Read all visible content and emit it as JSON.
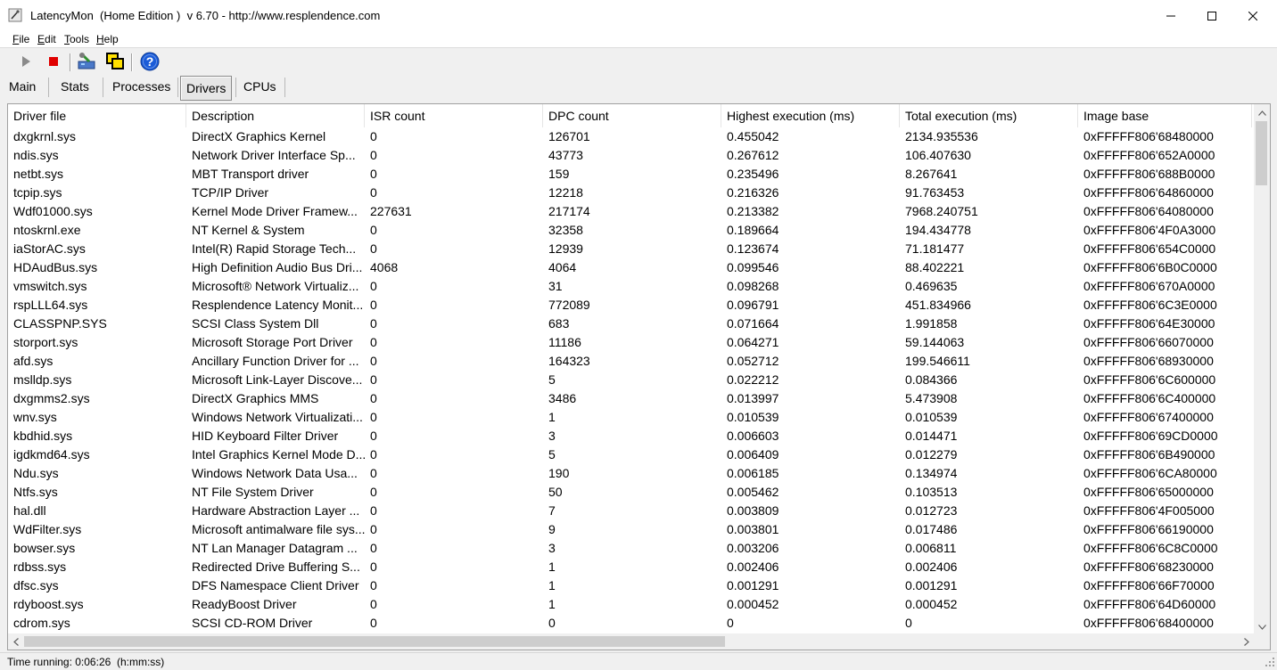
{
  "window": {
    "title": "LatencyMon  (Home Edition )  v 6.70 - http://www.resplendence.com",
    "icons": [
      "app-icon",
      "minimize-icon",
      "maximize-icon",
      "close-icon"
    ]
  },
  "menu": {
    "items": [
      {
        "accel": "F",
        "rest": "ile"
      },
      {
        "accel": "E",
        "rest": "dit"
      },
      {
        "accel": "T",
        "rest": "ools"
      },
      {
        "accel": "H",
        "rest": "elp"
      }
    ]
  },
  "toolbar": {
    "icons": [
      "play-icon",
      "stop-icon",
      "drivers-tool-icon",
      "windows-tool-icon",
      "help-icon"
    ],
    "colors": {
      "stop": "#e00000",
      "help": "#1a5bd8"
    }
  },
  "tabs": [
    {
      "label": "Main",
      "active": false
    },
    {
      "label": "Stats",
      "active": false
    },
    {
      "label": "Processes",
      "active": false
    },
    {
      "label": "Drivers",
      "active": true
    },
    {
      "label": "CPUs",
      "active": false
    }
  ],
  "table": {
    "columns": [
      "Driver file",
      "Description",
      "ISR count",
      "DPC count",
      "Highest execution (ms)",
      "Total execution (ms)",
      "Image base"
    ],
    "rows": [
      [
        "dxgkrnl.sys",
        "DirectX Graphics Kernel",
        "0",
        "126701",
        "0.455042",
        "2134.935536",
        "0xFFFFF806'68480000"
      ],
      [
        "ndis.sys",
        "Network Driver Interface Sp...",
        "0",
        "43773",
        "0.267612",
        "106.407630",
        "0xFFFFF806'652A0000"
      ],
      [
        "netbt.sys",
        "MBT Transport driver",
        "0",
        "159",
        "0.235496",
        "8.267641",
        "0xFFFFF806'688B0000"
      ],
      [
        "tcpip.sys",
        "TCP/IP Driver",
        "0",
        "12218",
        "0.216326",
        "91.763453",
        "0xFFFFF806'64860000"
      ],
      [
        "Wdf01000.sys",
        "Kernel Mode Driver Framew...",
        "227631",
        "217174",
        "0.213382",
        "7968.240751",
        "0xFFFFF806'64080000"
      ],
      [
        "ntoskrnl.exe",
        "NT Kernel & System",
        "0",
        "32358",
        "0.189664",
        "194.434778",
        "0xFFFFF806'4F0A3000"
      ],
      [
        "iaStorAC.sys",
        "Intel(R) Rapid Storage Tech...",
        "0",
        "12939",
        "0.123674",
        "71.181477",
        "0xFFFFF806'654C0000"
      ],
      [
        "HDAudBus.sys",
        "High Definition Audio Bus Dri...",
        "4068",
        "4064",
        "0.099546",
        "88.402221",
        "0xFFFFF806'6B0C0000"
      ],
      [
        "vmswitch.sys",
        "Microsoft® Network Virtualiz...",
        "0",
        "31",
        "0.098268",
        "0.469635",
        "0xFFFFF806'670A0000"
      ],
      [
        "rspLLL64.sys",
        "Resplendence Latency Monit...",
        "0",
        "772089",
        "0.096791",
        "451.834966",
        "0xFFFFF806'6C3E0000"
      ],
      [
        "CLASSPNP.SYS",
        "SCSI Class System Dll",
        "0",
        "683",
        "0.071664",
        "1.991858",
        "0xFFFFF806'64E30000"
      ],
      [
        "storport.sys",
        "Microsoft Storage Port Driver",
        "0",
        "11186",
        "0.064271",
        "59.144063",
        "0xFFFFF806'66070000"
      ],
      [
        "afd.sys",
        "Ancillary Function Driver for ...",
        "0",
        "164323",
        "0.052712",
        "199.546611",
        "0xFFFFF806'68930000"
      ],
      [
        "mslldp.sys",
        "Microsoft Link-Layer Discove...",
        "0",
        "5",
        "0.022212",
        "0.084366",
        "0xFFFFF806'6C600000"
      ],
      [
        "dxgmms2.sys",
        "DirectX Graphics MMS",
        "0",
        "3486",
        "0.013997",
        "5.473908",
        "0xFFFFF806'6C400000"
      ],
      [
        "wnv.sys",
        "Windows Network Virtualizati...",
        "0",
        "1",
        "0.010539",
        "0.010539",
        "0xFFFFF806'67400000"
      ],
      [
        "kbdhid.sys",
        "HID Keyboard Filter Driver",
        "0",
        "3",
        "0.006603",
        "0.014471",
        "0xFFFFF806'69CD0000"
      ],
      [
        "igdkmd64.sys",
        "Intel Graphics Kernel Mode D...",
        "0",
        "5",
        "0.006409",
        "0.012279",
        "0xFFFFF806'6B490000"
      ],
      [
        "Ndu.sys",
        "Windows Network Data Usa...",
        "0",
        "190",
        "0.006185",
        "0.134974",
        "0xFFFFF806'6CA80000"
      ],
      [
        "Ntfs.sys",
        "NT File System Driver",
        "0",
        "50",
        "0.005462",
        "0.103513",
        "0xFFFFF806'65000000"
      ],
      [
        "hal.dll",
        "Hardware Abstraction Layer ...",
        "0",
        "7",
        "0.003809",
        "0.012723",
        "0xFFFFF806'4F005000"
      ],
      [
        "WdFilter.sys",
        "Microsoft antimalware file sys...",
        "0",
        "9",
        "0.003801",
        "0.017486",
        "0xFFFFF806'66190000"
      ],
      [
        "bowser.sys",
        "NT Lan Manager Datagram ...",
        "0",
        "3",
        "0.003206",
        "0.006811",
        "0xFFFFF806'6C8C0000"
      ],
      [
        "rdbss.sys",
        "Redirected Drive Buffering S...",
        "0",
        "1",
        "0.002406",
        "0.002406",
        "0xFFFFF806'68230000"
      ],
      [
        "dfsc.sys",
        "DFS Namespace Client Driver",
        "0",
        "1",
        "0.001291",
        "0.001291",
        "0xFFFFF806'66F70000"
      ],
      [
        "rdyboost.sys",
        "ReadyBoost Driver",
        "0",
        "1",
        "0.000452",
        "0.000452",
        "0xFFFFF806'64D60000"
      ],
      [
        "cdrom.sys",
        "SCSI CD-ROM Driver",
        "0",
        "0",
        "0",
        "0",
        "0xFFFFF806'68400000"
      ]
    ]
  },
  "statusbar": {
    "text": "Time running: 0:06:26  (h:mm:ss)"
  }
}
